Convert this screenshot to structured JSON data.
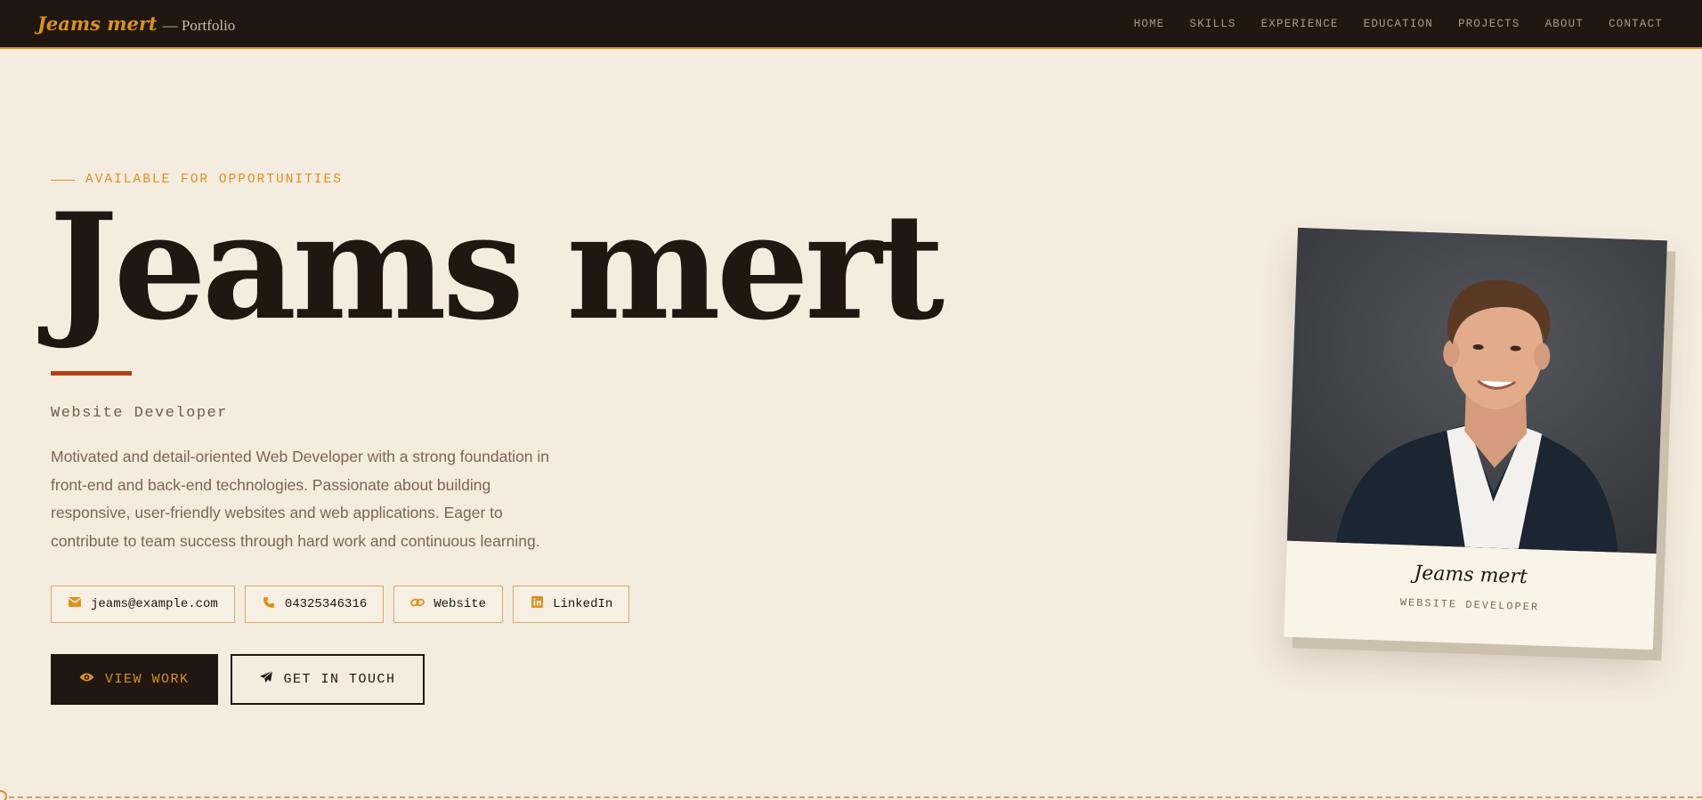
{
  "nav": {
    "brand_name": "Jeams mert",
    "brand_sub": "— Portfolio",
    "links": [
      "HOME",
      "SKILLS",
      "EXPERIENCE",
      "EDUCATION",
      "PROJECTS",
      "ABOUT",
      "CONTACT"
    ]
  },
  "hero": {
    "eyebrow": "AVAILABLE FOR OPPORTUNITIES",
    "name": "Jeams mert",
    "role": "Website Developer",
    "bio": "Motivated and detail-oriented Web Developer with a strong foundation in front-end and back-end technologies. Passionate about building responsive, user-friendly websites and web applications. Eager to contribute to team success through hard work and continuous learning.",
    "contacts": {
      "email": {
        "label": "jeams@example.com",
        "icon": "envelope-icon"
      },
      "phone": {
        "label": "04325346316",
        "icon": "phone-icon"
      },
      "website": {
        "label": "Website",
        "icon": "link-icon"
      },
      "linkedin": {
        "label": "LinkedIn",
        "icon": "linkedin-icon"
      }
    },
    "cta_primary": {
      "label": "VIEW WORK",
      "icon": "eye-icon"
    },
    "cta_secondary": {
      "label": "GET IN TOUCH",
      "icon": "paper-plane-icon"
    }
  },
  "polaroid": {
    "caption_name": "Jeams mert",
    "caption_role": "WEBSITE DEVELOPER"
  },
  "colors": {
    "background": "#f5ece0",
    "dark": "#1f1710",
    "accent": "#d9921e",
    "rust": "#b63d16"
  }
}
